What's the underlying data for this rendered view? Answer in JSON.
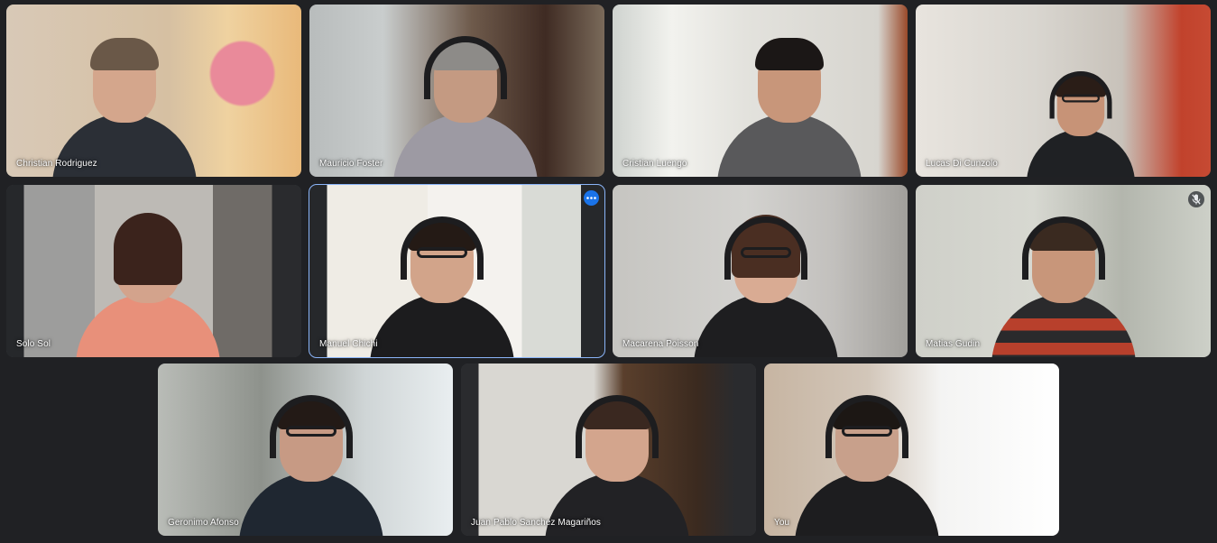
{
  "participants": [
    {
      "name": "Christian Rodriguez",
      "active": false,
      "muted": false
    },
    {
      "name": "Mauricio Foster",
      "active": false,
      "muted": false
    },
    {
      "name": "Cristian Luengo",
      "active": false,
      "muted": false
    },
    {
      "name": "Lucas Di Cunzolo",
      "active": false,
      "muted": false
    },
    {
      "name": "Solo Sol",
      "active": false,
      "muted": false
    },
    {
      "name": "Manuel Chichi",
      "active": true,
      "muted": false
    },
    {
      "name": "Macarena Poisson",
      "active": false,
      "muted": false
    },
    {
      "name": "Matias Gudin",
      "active": false,
      "muted": true
    },
    {
      "name": "Geronimo Afonso",
      "active": false,
      "muted": false
    },
    {
      "name": "Juan Pablo Sanchez Magariños",
      "active": false,
      "muted": false
    },
    {
      "name": "You",
      "active": false,
      "muted": false
    }
  ],
  "icons": {
    "more_options": "more-options-icon",
    "mic_off": "mic-off-icon"
  },
  "colors": {
    "background": "#202124",
    "active_outline": "#8ab4f8",
    "more_button": "#1a73e8"
  }
}
